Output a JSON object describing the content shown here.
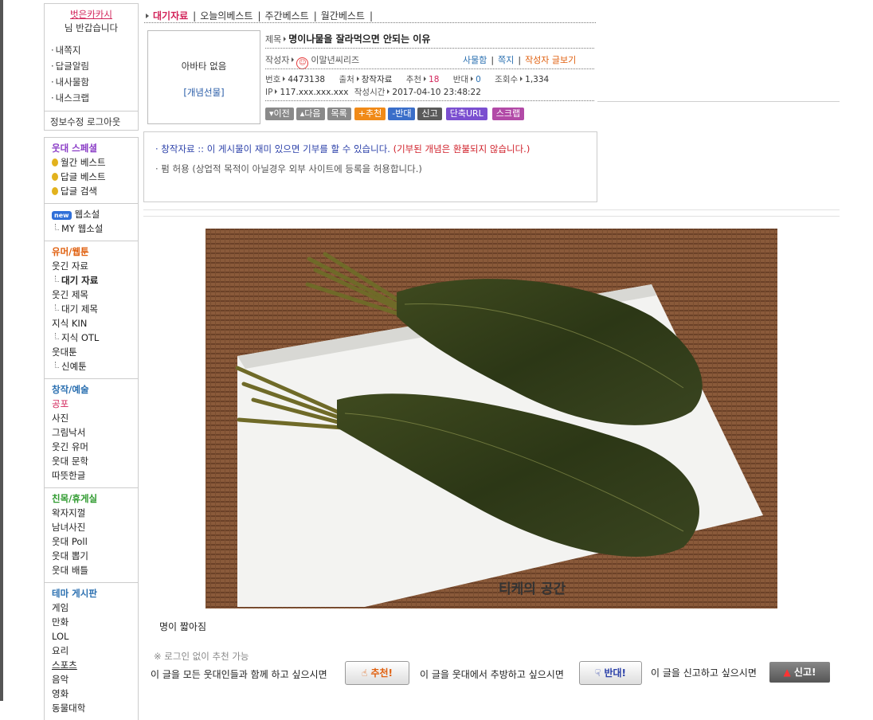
{
  "user": {
    "name": "벗은카카시",
    "greeting": "님 반갑습니다",
    "menu": [
      "내쪽지",
      "답글알림",
      "내사물함",
      "내스크랩"
    ],
    "account": "정보수정 로그아웃"
  },
  "sidebar": {
    "special": {
      "title": "웃대 스페셜",
      "items": [
        "월간 베스트",
        "답글 베스트",
        "답글 검색"
      ]
    },
    "webnovel": {
      "badge": "new",
      "title": "웹소설",
      "sub": "MY 웹소설"
    },
    "humor": {
      "title": "유머/웹툰",
      "items": [
        "웃긴 자료",
        "대기 자료",
        "웃긴 제목",
        "대기 제목",
        "지식 KIN",
        "지식 OTL",
        "웃대툰",
        "신예툰"
      ]
    },
    "art": {
      "title": "창작/예술",
      "items": [
        "공포",
        "사진",
        "그림낙서",
        "웃긴 유머",
        "웃대 문학",
        "따뜻한글"
      ]
    },
    "social": {
      "title": "친목/휴게실",
      "items": [
        "왁자지껄",
        "남녀사진",
        "웃대 Poll",
        "웃대 뽑기",
        "웃대 배틀"
      ]
    },
    "theme": {
      "title": "테마 게시판",
      "items": [
        "게임",
        "만화",
        "LOL",
        "요리",
        "스포츠",
        "음악",
        "영화",
        "동물대학"
      ]
    }
  },
  "tabs": [
    "대기자료",
    "오늘의베스트",
    "주간베스트",
    "월간베스트"
  ],
  "post": {
    "avatar_text": "아바타 없음",
    "gift_link": "[개념선물]",
    "title_label": "제목",
    "title": "명이나물을 잘라먹으면 안되는 이유",
    "author_label": "작성자",
    "author": "이말년씨리즈",
    "author_links": [
      "사물함",
      "쪽지",
      "작성자 글보기"
    ],
    "no_label": "번호",
    "no": "4473138",
    "source_label": "출처",
    "source": "창작자료",
    "rec_label": "추천",
    "rec": "18",
    "opp_label": "반대",
    "opp": "0",
    "views_label": "조회수",
    "views": "1,334",
    "ip_label": "IP",
    "ip": "117.xxx.xxx.xxx",
    "time_label": "작성시간",
    "time": "2017-04-10 23:48:22"
  },
  "buttons": [
    {
      "label": "▾이전",
      "color": "#8a8a8a"
    },
    {
      "label": "▴다음",
      "color": "#8a8a8a"
    },
    {
      "label": "목록",
      "color": "#8a8a8a"
    },
    {
      "label": "+추천",
      "color": "#f08a18"
    },
    {
      "label": "-반대",
      "color": "#3a6ec9"
    },
    {
      "label": "신고",
      "color": "#5a5a5a"
    },
    {
      "label": "단축URL",
      "color": "#7b4fd0"
    },
    {
      "label": "스크랩",
      "color": "#b24aa7"
    }
  ],
  "notice": {
    "line1_a": "· 창작자료 :: 이 게시물이 재미 있으면 기부를 할 수 있습니다.",
    "line1_b": "(기부된 개념은 환불되지 않습니다.)",
    "line2": "· 펌 허용 (상업적 목적이 아닐경우 외부 사이트에 등록을 허용합니다.)"
  },
  "image": {
    "watermark": "티케의 공간"
  },
  "caption": "명이 짧아짐",
  "actions": {
    "nologin": "※ 로그인 없이 추천 가능",
    "rec_text": "이 글을 모든 웃대인들과 함께 하고 싶으시면",
    "rec_btn": "추천!",
    "opp_text": "이 글을 웃대에서 추방하고 싶으시면",
    "opp_btn": "반대!",
    "report_text": "이 글을 신고하고 싶으시면",
    "report_btn": "신고!"
  },
  "colors": {
    "accent": "#d2245a",
    "orange": "#e0600f",
    "green": "#2e9a2e",
    "purple": "#8a3cc6",
    "blue": "#2a6fb0"
  }
}
